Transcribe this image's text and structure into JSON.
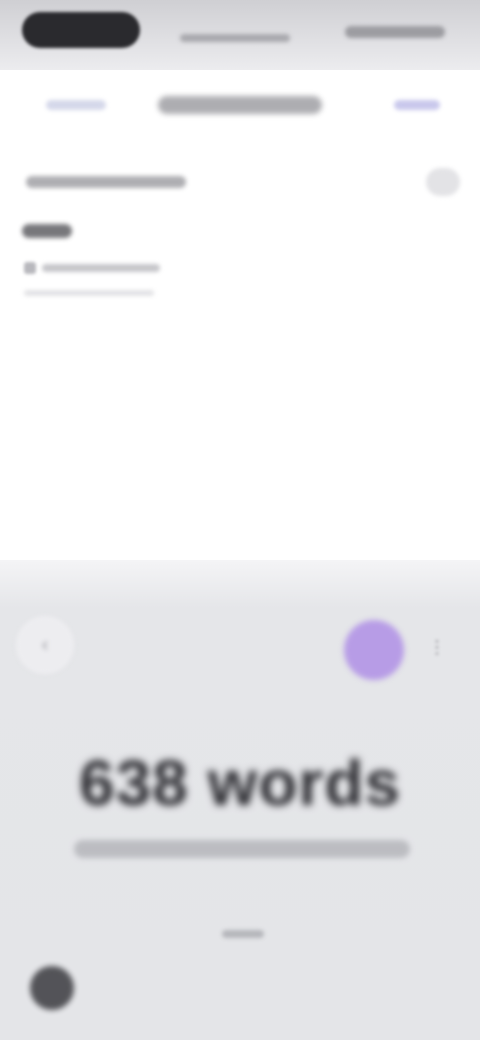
{
  "main": {
    "word_count": "638 words"
  },
  "icons": {
    "sheet_close": "chevron-icon",
    "more": "more-icon",
    "record": "microphone-icon",
    "keyboard": "keyboard-icon"
  },
  "colors": {
    "accent": "#b79ce6",
    "sheet_background": "#e5e6e9"
  }
}
